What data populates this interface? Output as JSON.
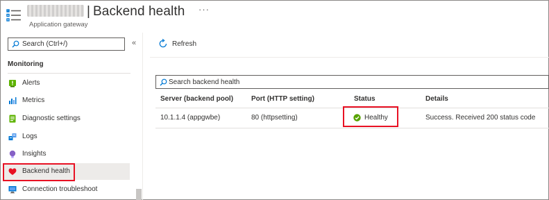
{
  "header": {
    "title": "Backend health",
    "separator": "|",
    "subtitle": "Application gateway",
    "more_label": "···"
  },
  "sidebar": {
    "search_placeholder": "Search (Ctrl+/)",
    "collapse_label": "«",
    "group_label": "Monitoring",
    "items": [
      {
        "label": "Alerts",
        "icon": "alerts-icon"
      },
      {
        "label": "Metrics",
        "icon": "metrics-icon"
      },
      {
        "label": "Diagnostic settings",
        "icon": "diagnostic-settings-icon"
      },
      {
        "label": "Logs",
        "icon": "logs-icon"
      },
      {
        "label": "Insights",
        "icon": "insights-icon"
      },
      {
        "label": "Backend health",
        "icon": "heart-icon",
        "selected": true
      },
      {
        "label": "Connection troubleshoot",
        "icon": "monitor-icon"
      }
    ]
  },
  "toolbar": {
    "refresh_label": "Refresh"
  },
  "table": {
    "search_placeholder": "Search backend health",
    "columns": [
      "Server (backend pool)",
      "Port (HTTP setting)",
      "Status",
      "Details"
    ],
    "rows": [
      {
        "server": "10.1.1.4 (appgwbe)",
        "port": "80 (httpsetting)",
        "status": "Healthy",
        "details": "Success. Received 200 status code"
      }
    ]
  },
  "colors": {
    "accent": "#0078d4",
    "healthy": "#57a300",
    "highlight_box": "#e81123",
    "heart": "#e81123"
  }
}
